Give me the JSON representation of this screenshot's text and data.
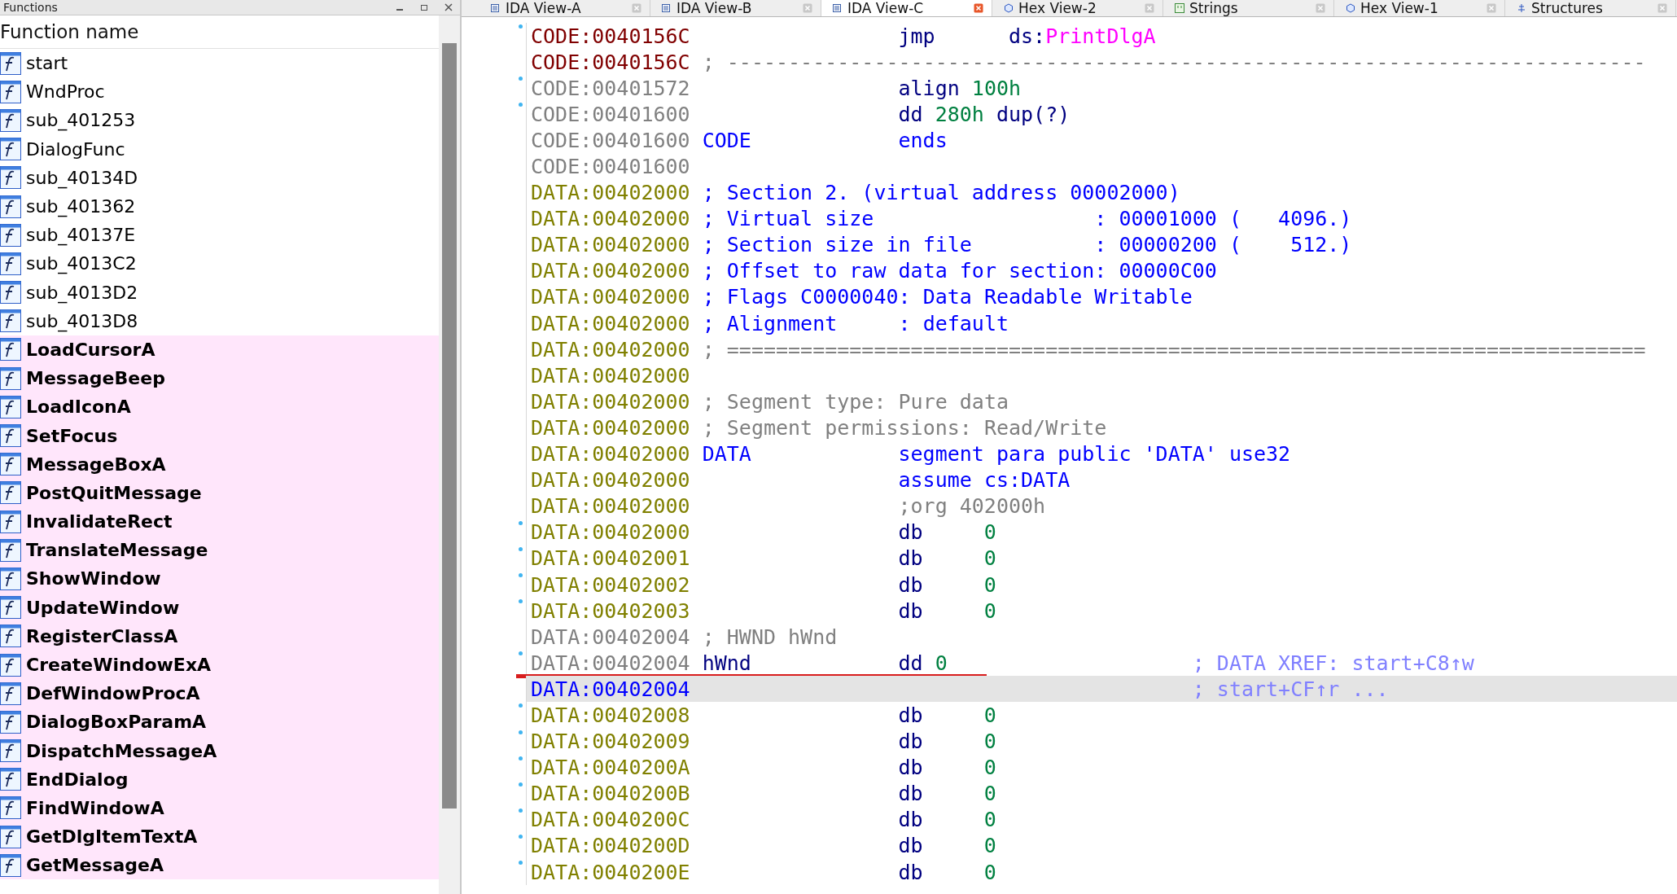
{
  "functions_panel": {
    "title": "Functions",
    "column_header": "Function name",
    "items": [
      {
        "name": "start",
        "kind": "function"
      },
      {
        "name": "WndProc",
        "kind": "function"
      },
      {
        "name": "sub_401253",
        "kind": "function"
      },
      {
        "name": "DialogFunc",
        "kind": "function"
      },
      {
        "name": "sub_40134D",
        "kind": "function"
      },
      {
        "name": "sub_401362",
        "kind": "function"
      },
      {
        "name": "sub_40137E",
        "kind": "function"
      },
      {
        "name": "sub_4013C2",
        "kind": "function"
      },
      {
        "name": "sub_4013D2",
        "kind": "function"
      },
      {
        "name": "sub_4013D8",
        "kind": "function"
      },
      {
        "name": "LoadCursorA",
        "kind": "import"
      },
      {
        "name": "MessageBeep",
        "kind": "import"
      },
      {
        "name": "LoadIconA",
        "kind": "import"
      },
      {
        "name": "SetFocus",
        "kind": "import"
      },
      {
        "name": "MessageBoxA",
        "kind": "import"
      },
      {
        "name": "PostQuitMessage",
        "kind": "import"
      },
      {
        "name": "InvalidateRect",
        "kind": "import"
      },
      {
        "name": "TranslateMessage",
        "kind": "import"
      },
      {
        "name": "ShowWindow",
        "kind": "import"
      },
      {
        "name": "UpdateWindow",
        "kind": "import"
      },
      {
        "name": "RegisterClassA",
        "kind": "import"
      },
      {
        "name": "CreateWindowExA",
        "kind": "import"
      },
      {
        "name": "DefWindowProcA",
        "kind": "import"
      },
      {
        "name": "DialogBoxParamA",
        "kind": "import"
      },
      {
        "name": "DispatchMessageA",
        "kind": "import"
      },
      {
        "name": "EndDialog",
        "kind": "import"
      },
      {
        "name": "FindWindowA",
        "kind": "import"
      },
      {
        "name": "GetDlgItemTextA",
        "kind": "import"
      },
      {
        "name": "GetMessageA",
        "kind": "import"
      }
    ]
  },
  "tabs": [
    {
      "label": "IDA View-A",
      "kind": "listing",
      "selected": false
    },
    {
      "label": "IDA View-B",
      "kind": "listing",
      "selected": false
    },
    {
      "label": "IDA View-C",
      "kind": "listing",
      "selected": true
    },
    {
      "label": "Hex View-2",
      "kind": "hex",
      "selected": false
    },
    {
      "label": "Strings",
      "kind": "strings",
      "selected": false
    },
    {
      "label": "Hex View-1",
      "kind": "hex",
      "selected": false
    },
    {
      "label": "Structures",
      "kind": "struct",
      "selected": false
    }
  ],
  "listing": [
    {
      "dot": true,
      "addr": {
        "text": "CODE:0040156C",
        "kind": "code"
      },
      "selected": false,
      "underlined": false,
      "kind": "instr",
      "op": {
        "text": "jmp",
        "kind": "keyword"
      },
      "args": [
        {
          "text": "ds:",
          "kind": "keyword"
        },
        {
          "text": "PrintDlgA",
          "kind": "import"
        }
      ]
    },
    {
      "dot": false,
      "addr": {
        "text": "CODE:0040156C",
        "kind": "code"
      },
      "selected": false,
      "underlined": false,
      "note": {
        "text": "; ---------------------------------------------------------------------------",
        "kind": "muted"
      }
    },
    {
      "dot": true,
      "addr": {
        "text": "CODE:00401572",
        "kind": "plain"
      },
      "selected": false,
      "underlined": false,
      "kind": "directive",
      "op": {
        "text": "align",
        "kind": "keyword"
      },
      "args": [
        {
          "text": "100h",
          "kind": "number"
        }
      ]
    },
    {
      "dot": true,
      "addr": {
        "text": "CODE:00401600",
        "kind": "plain"
      },
      "selected": false,
      "underlined": false,
      "kind": "directive",
      "op": {
        "text": "dd",
        "kind": "keyword"
      },
      "args": [
        {
          "text": "280h",
          "kind": "number"
        },
        {
          "text": " dup(?)",
          "kind": "keyword"
        }
      ]
    },
    {
      "dot": false,
      "addr": {
        "text": "CODE:00401600",
        "kind": "plain"
      },
      "selected": false,
      "underlined": false,
      "label": {
        "text": "CODE",
        "kind": "directive"
      },
      "kind": "directive",
      "op": {
        "text": "ends",
        "kind": "directive"
      }
    },
    {
      "dot": false,
      "addr": {
        "text": "CODE:00401600",
        "kind": "plain"
      },
      "selected": false,
      "underlined": false
    },
    {
      "dot": false,
      "addr": {
        "text": "DATA:00402000",
        "kind": "data"
      },
      "selected": false,
      "underlined": false,
      "note": {
        "text": "; Section 2. (virtual address 00002000)",
        "kind": "comment"
      }
    },
    {
      "dot": false,
      "addr": {
        "text": "DATA:00402000",
        "kind": "data"
      },
      "selected": false,
      "underlined": false,
      "note": {
        "text": "; Virtual size                  : 00001000 (   4096.)",
        "kind": "comment"
      }
    },
    {
      "dot": false,
      "addr": {
        "text": "DATA:00402000",
        "kind": "data"
      },
      "selected": false,
      "underlined": false,
      "note": {
        "text": "; Section size in file          : 00000200 (    512.)",
        "kind": "comment"
      }
    },
    {
      "dot": false,
      "addr": {
        "text": "DATA:00402000",
        "kind": "data"
      },
      "selected": false,
      "underlined": false,
      "note": {
        "text": "; Offset to raw data for section: 00000C00",
        "kind": "comment"
      }
    },
    {
      "dot": false,
      "addr": {
        "text": "DATA:00402000",
        "kind": "data"
      },
      "selected": false,
      "underlined": false,
      "note": {
        "text": "; Flags C0000040: Data Readable Writable",
        "kind": "comment"
      }
    },
    {
      "dot": false,
      "addr": {
        "text": "DATA:00402000",
        "kind": "data"
      },
      "selected": false,
      "underlined": false,
      "note": {
        "text": "; Alignment     : default",
        "kind": "comment"
      }
    },
    {
      "dot": false,
      "addr": {
        "text": "DATA:00402000",
        "kind": "data"
      },
      "selected": false,
      "underlined": false,
      "note": {
        "text": "; ===========================================================================",
        "kind": "muted"
      }
    },
    {
      "dot": false,
      "addr": {
        "text": "DATA:00402000",
        "kind": "data"
      },
      "selected": false,
      "underlined": false
    },
    {
      "dot": false,
      "addr": {
        "text": "DATA:00402000",
        "kind": "data"
      },
      "selected": false,
      "underlined": false,
      "note": {
        "text": "; Segment type: Pure data",
        "kind": "muted"
      }
    },
    {
      "dot": false,
      "addr": {
        "text": "DATA:00402000",
        "kind": "data"
      },
      "selected": false,
      "underlined": false,
      "note": {
        "text": "; Segment permissions: Read/Write",
        "kind": "muted"
      }
    },
    {
      "dot": false,
      "addr": {
        "text": "DATA:00402000",
        "kind": "data"
      },
      "selected": false,
      "underlined": false,
      "label": {
        "text": "DATA",
        "kind": "directive"
      },
      "kind": "directive",
      "op": {
        "text": "segment",
        "kind": "directive"
      },
      "args": [
        {
          "text": "para public 'DATA' use32",
          "kind": "directive"
        }
      ]
    },
    {
      "dot": false,
      "addr": {
        "text": "DATA:00402000",
        "kind": "data"
      },
      "selected": false,
      "underlined": false,
      "kind": "directive",
      "op": {
        "text": "assume",
        "kind": "directive"
      },
      "args": [
        {
          "text": "cs:DATA",
          "kind": "directive"
        }
      ]
    },
    {
      "dot": false,
      "addr": {
        "text": "DATA:00402000",
        "kind": "data"
      },
      "selected": false,
      "underlined": false,
      "kind": "directive",
      "op": {
        "text": ";org 402000h",
        "kind": "muted"
      }
    },
    {
      "dot": true,
      "addr": {
        "text": "DATA:00402000",
        "kind": "data"
      },
      "selected": false,
      "underlined": false,
      "kind": "item",
      "op": {
        "text": "db",
        "kind": "keyword"
      },
      "args": [
        {
          "text": "0",
          "kind": "number"
        }
      ]
    },
    {
      "dot": true,
      "addr": {
        "text": "DATA:00402001",
        "kind": "data"
      },
      "selected": false,
      "underlined": false,
      "kind": "item",
      "op": {
        "text": "db",
        "kind": "keyword"
      },
      "args": [
        {
          "text": "0",
          "kind": "number"
        }
      ]
    },
    {
      "dot": true,
      "addr": {
        "text": "DATA:00402002",
        "kind": "data"
      },
      "selected": false,
      "underlined": false,
      "kind": "item",
      "op": {
        "text": "db",
        "kind": "keyword"
      },
      "args": [
        {
          "text": "0",
          "kind": "number"
        }
      ]
    },
    {
      "dot": true,
      "addr": {
        "text": "DATA:00402003",
        "kind": "data"
      },
      "selected": false,
      "underlined": false,
      "kind": "item",
      "op": {
        "text": "db",
        "kind": "keyword"
      },
      "args": [
        {
          "text": "0",
          "kind": "number"
        }
      ]
    },
    {
      "dot": false,
      "addr": {
        "text": "DATA:00402004",
        "kind": "plain"
      },
      "selected": false,
      "underlined": false,
      "note": {
        "text": "; HWND hWnd",
        "kind": "muted"
      }
    },
    {
      "dot": true,
      "addr": {
        "text": "DATA:00402004",
        "kind": "plain"
      },
      "selected": false,
      "underlined": true,
      "label": {
        "text": "hWnd",
        "kind": "keyword"
      },
      "kind": "directive",
      "op": {
        "text": "dd",
        "kind": "keyword"
      },
      "args": [
        {
          "text": "0",
          "kind": "number"
        }
      ],
      "xref": "; DATA XREF: start+C8↑w"
    },
    {
      "dot": false,
      "addr": {
        "text": "DATA:00402004",
        "kind": "current"
      },
      "selected": true,
      "underlined": false,
      "xref": "; start+CF↑r ..."
    },
    {
      "dot": true,
      "addr": {
        "text": "DATA:00402008",
        "kind": "data"
      },
      "selected": false,
      "underlined": false,
      "kind": "item",
      "op": {
        "text": "db",
        "kind": "keyword"
      },
      "args": [
        {
          "text": "0",
          "kind": "number"
        }
      ]
    },
    {
      "dot": true,
      "addr": {
        "text": "DATA:00402009",
        "kind": "data"
      },
      "selected": false,
      "underlined": false,
      "kind": "item",
      "op": {
        "text": "db",
        "kind": "keyword"
      },
      "args": [
        {
          "text": "0",
          "kind": "number"
        }
      ]
    },
    {
      "dot": true,
      "addr": {
        "text": "DATA:0040200A",
        "kind": "data"
      },
      "selected": false,
      "underlined": false,
      "kind": "item",
      "op": {
        "text": "db",
        "kind": "keyword"
      },
      "args": [
        {
          "text": "0",
          "kind": "number"
        }
      ]
    },
    {
      "dot": true,
      "addr": {
        "text": "DATA:0040200B",
        "kind": "data"
      },
      "selected": false,
      "underlined": false,
      "kind": "item",
      "op": {
        "text": "db",
        "kind": "keyword"
      },
      "args": [
        {
          "text": "0",
          "kind": "number"
        }
      ]
    },
    {
      "dot": true,
      "addr": {
        "text": "DATA:0040200C",
        "kind": "data"
      },
      "selected": false,
      "underlined": false,
      "kind": "item",
      "op": {
        "text": "db",
        "kind": "keyword"
      },
      "args": [
        {
          "text": "0",
          "kind": "number"
        }
      ]
    },
    {
      "dot": true,
      "addr": {
        "text": "DATA:0040200D",
        "kind": "data"
      },
      "selected": false,
      "underlined": false,
      "kind": "item",
      "op": {
        "text": "db",
        "kind": "keyword"
      },
      "args": [
        {
          "text": "0",
          "kind": "number"
        }
      ]
    },
    {
      "dot": true,
      "addr": {
        "text": "DATA:0040200E",
        "kind": "data"
      },
      "selected": false,
      "underlined": false,
      "kind": "item",
      "op": {
        "text": "db",
        "kind": "keyword"
      },
      "args": [
        {
          "text": "0",
          "kind": "number"
        }
      ]
    }
  ]
}
